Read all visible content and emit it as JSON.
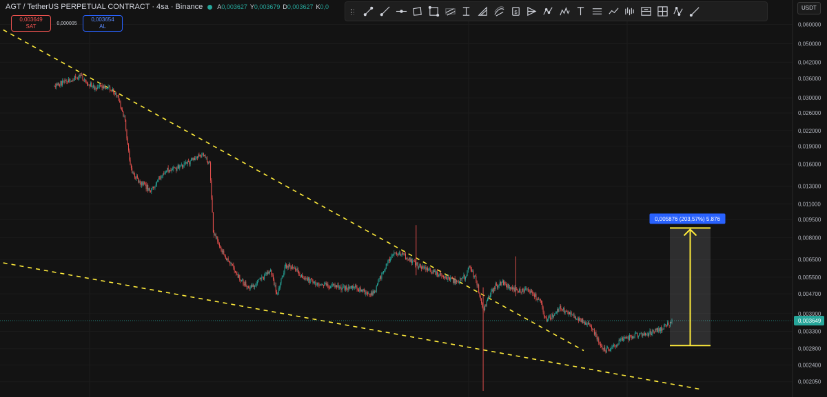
{
  "header": {
    "title": "AGT / TetherUS PERPETUAL CONTRACT · 4sa · Binance",
    "ohlc": [
      {
        "k": "A",
        "v": "0,003627"
      },
      {
        "k": "Y",
        "v": "0,003679"
      },
      {
        "k": "D",
        "v": "0,003627"
      },
      {
        "k": "K",
        "v": "0,0"
      }
    ]
  },
  "trade": {
    "sell_price": "0,003649",
    "sell_label": "SAT",
    "spread": "0,000005",
    "buy_price": "0,003654",
    "buy_label": "AL"
  },
  "currency": "USDT",
  "toolbar_tools": [
    "trend-line",
    "ray-line",
    "horizontal-line",
    "rectangle",
    "box",
    "parallel-channel",
    "vertical-line",
    "triangle",
    "curve",
    "price-label",
    "forecast",
    "zigzag",
    "pattern",
    "text",
    "range",
    "path",
    "bars-pattern",
    "long-short",
    "fib-grid",
    "xabcd",
    "brush"
  ],
  "colors": {
    "background": "#131313",
    "up": "#26a69a",
    "down": "#ef5350",
    "trendline": "#ffeb3b",
    "measure": "#ffeb3b",
    "measure_label": "#2962ff",
    "last_price": "#26a69a",
    "scale_text": "#b2b5be"
  },
  "chart_data": {
    "type": "candlestick",
    "symbol": "AGT/USDT perpetual",
    "interval": "4h",
    "scale": "log",
    "ylim": [
      0.00188,
      0.069
    ],
    "y_ticks": [
      "0,060000",
      "0,050000",
      "0,042000",
      "0,036000",
      "0,030000",
      "0,026000",
      "0,022000",
      "0,019000",
      "0,016000",
      "0,013000",
      "0,011000",
      "0,009500",
      "0,008000",
      "0,006500",
      "0,005500",
      "0,004700",
      "0,003900",
      "0,003300",
      "0,002800",
      "0,002400",
      "0,002050"
    ],
    "last_price": "0,003649",
    "price_path": [
      [
        0,
        0.0335
      ],
      [
        15,
        0.0355
      ],
      [
        30,
        0.0365
      ],
      [
        45,
        0.033
      ],
      [
        60,
        0.0335
      ],
      [
        72,
        0.0305
      ],
      [
        80,
        0.024
      ],
      [
        86,
        0.0155
      ],
      [
        96,
        0.0135
      ],
      [
        110,
        0.0125
      ],
      [
        125,
        0.015
      ],
      [
        140,
        0.0155
      ],
      [
        155,
        0.0165
      ],
      [
        168,
        0.0175
      ],
      [
        176,
        0.016
      ],
      [
        180,
        0.0085
      ],
      [
        190,
        0.007
      ],
      [
        200,
        0.0062
      ],
      [
        212,
        0.0053
      ],
      [
        222,
        0.005
      ],
      [
        235,
        0.0054
      ],
      [
        245,
        0.0059
      ],
      [
        252,
        0.0047
      ],
      [
        262,
        0.0061
      ],
      [
        272,
        0.006
      ],
      [
        282,
        0.0055
      ],
      [
        295,
        0.0052
      ],
      [
        310,
        0.0051
      ],
      [
        325,
        0.005
      ],
      [
        340,
        0.005
      ],
      [
        352,
        0.0048
      ],
      [
        362,
        0.0047
      ],
      [
        372,
        0.0058
      ],
      [
        385,
        0.007
      ],
      [
        395,
        0.0068
      ],
      [
        410,
        0.0062
      ],
      [
        425,
        0.0059
      ],
      [
        440,
        0.0055
      ],
      [
        455,
        0.0053
      ],
      [
        465,
        0.0055
      ],
      [
        470,
        0.006
      ],
      [
        478,
        0.0054
      ],
      [
        486,
        0.004
      ],
      [
        493,
        0.0046
      ],
      [
        500,
        0.0051
      ],
      [
        508,
        0.0052
      ],
      [
        516,
        0.005
      ],
      [
        526,
        0.0048
      ],
      [
        535,
        0.0049
      ],
      [
        545,
        0.0046
      ],
      [
        552,
        0.0044
      ],
      [
        556,
        0.0037
      ],
      [
        564,
        0.0038
      ],
      [
        572,
        0.0041
      ],
      [
        580,
        0.004
      ],
      [
        590,
        0.0038
      ],
      [
        600,
        0.0036
      ],
      [
        610,
        0.0034
      ],
      [
        615,
        0.0031
      ],
      [
        620,
        0.0029
      ],
      [
        625,
        0.00275
      ],
      [
        632,
        0.00285
      ],
      [
        640,
        0.003
      ],
      [
        650,
        0.0031
      ],
      [
        660,
        0.0032
      ],
      [
        670,
        0.0032
      ],
      [
        680,
        0.0033
      ],
      [
        690,
        0.0034
      ],
      [
        700,
        0.00362
      ]
    ],
    "trendlines": [
      {
        "name": "upper",
        "style": "dashed",
        "points": [
          [
            -58,
            0.057
          ],
          [
            600,
            0.00275
          ]
        ]
      },
      {
        "name": "lower",
        "style": "dashed",
        "points": [
          [
            -58,
            0.0063
          ],
          [
            735,
            0.0019
          ]
        ]
      }
    ],
    "measure": {
      "bottom": 0.002883,
      "top": 0.008759,
      "label": "0,005876 (203,57%) 5.876"
    },
    "wicks": [
      {
        "at": 486,
        "low": 0.00188,
        "high": 0.005
      },
      {
        "at": 410,
        "low": 0.0056,
        "high": 0.009
      },
      {
        "at": 523,
        "low": 0.0046,
        "high": 0.0067
      }
    ]
  }
}
